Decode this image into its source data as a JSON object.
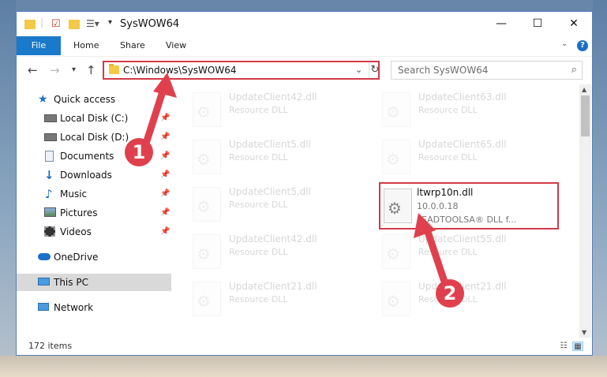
{
  "window": {
    "title": "SysWOW64",
    "controls": {
      "minimize": "—",
      "maximize": "☐",
      "close": "✕"
    }
  },
  "ribbon": {
    "file": "File",
    "tabs": [
      "Home",
      "Share",
      "View"
    ],
    "help": "?"
  },
  "address": {
    "path": "C:\\Windows\\SysWOW64",
    "refresh_icon": "↻"
  },
  "search": {
    "placeholder": "Search SysWOW64"
  },
  "navigation": {
    "items": [
      {
        "label": "Quick access",
        "icon": "star-icon",
        "pinned": false
      },
      {
        "label": "Local Disk (C:)",
        "icon": "drive-icon",
        "pinned": true
      },
      {
        "label": "Local Disk (D:)",
        "icon": "drive-icon",
        "pinned": true
      },
      {
        "label": "Documents",
        "icon": "documents-icon",
        "pinned": true
      },
      {
        "label": "Downloads",
        "icon": "download-icon",
        "pinned": true
      },
      {
        "label": "Music",
        "icon": "music-icon",
        "pinned": true
      },
      {
        "label": "Pictures",
        "icon": "pictures-icon",
        "pinned": true
      },
      {
        "label": "Videos",
        "icon": "videos-icon",
        "pinned": true
      },
      {
        "label": "OneDrive",
        "icon": "cloud-icon",
        "pinned": false
      },
      {
        "label": "This PC",
        "icon": "pc-icon",
        "pinned": false,
        "selected": true
      },
      {
        "label": "Network",
        "icon": "network-icon",
        "pinned": false
      }
    ]
  },
  "files": [
    {
      "name": "UpdateClient42.dll",
      "type": "Resource DLL",
      "faded": true
    },
    {
      "name": "UpdateClient63.dll",
      "type": "Resource DLL",
      "faded": true
    },
    {
      "name": "UpdateClient5.dll",
      "type": "Resource DLL",
      "faded": true
    },
    {
      "name": "UpdateClient65.dll",
      "type": "Resource DLL",
      "faded": true
    },
    {
      "name": "UpdateClient5.dll",
      "type": "Resource DLL",
      "faded": true
    },
    {
      "name": "ltwrp10n.dll",
      "type": "10.0.0.18",
      "desc": "LEADTOOLSA® DLL f...",
      "faded": false,
      "highlighted": true
    },
    {
      "name": "UpdateClient42.dll",
      "type": "Resource DLL",
      "faded": true
    },
    {
      "name": "UpdateClient55.dll",
      "type": "Resource DLL",
      "faded": true
    },
    {
      "name": "UpdateClient21.dll",
      "type": "Resource DLL",
      "faded": true
    },
    {
      "name": "UpdateClient21.dll",
      "type": "Resource DLL",
      "faded": true
    }
  ],
  "status": {
    "items": "172 items"
  },
  "annotations": {
    "step1": "1",
    "step2": "2"
  },
  "colors": {
    "accent": "#1979ca",
    "highlight": "#d23a48",
    "badge": "#e0404d"
  }
}
